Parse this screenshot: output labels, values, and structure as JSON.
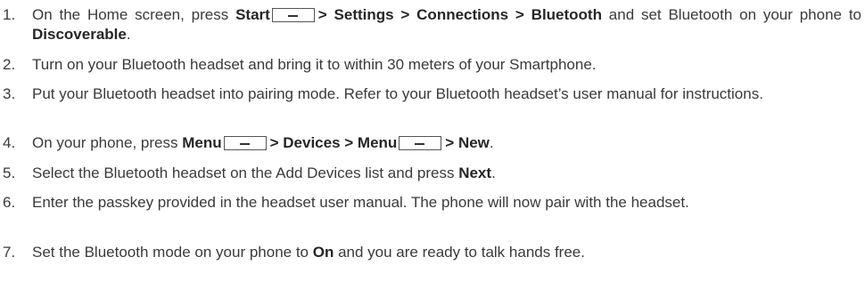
{
  "steps": [
    {
      "number": "1.",
      "parts": {
        "a": "On the Home screen, press ",
        "b": "Start",
        "c": "> Settings > Connections > Bluetooth",
        "d": " and set Bluetooth on your phone to ",
        "e": "Discoverable",
        "f": "."
      }
    },
    {
      "number": "2.",
      "text": "Turn on your Bluetooth headset and bring it to within 30 meters of your Smartphone."
    },
    {
      "number": "3.",
      "text": "Put your Bluetooth headset into pairing mode. Refer to your Bluetooth headset’s user manual for instructions."
    },
    {
      "number": "4.",
      "parts": {
        "a": "On your phone, press ",
        "b": "Menu",
        "c": "> Devices > Menu",
        "d": "> New",
        "e": "."
      }
    },
    {
      "number": "5.",
      "parts": {
        "a": "Select the Bluetooth headset on the Add Devices list and press ",
        "b": "Next",
        "c": "."
      }
    },
    {
      "number": "6.",
      "text": "Enter the passkey provided in the headset user manual. The phone will now pair with the headset."
    },
    {
      "number": "7.",
      "parts": {
        "a": "Set the Bluetooth mode on your phone to ",
        "b": "On",
        "c": " and you are ready to talk hands free."
      }
    }
  ],
  "icons": {
    "softkey": "softkey-minus-icon"
  }
}
